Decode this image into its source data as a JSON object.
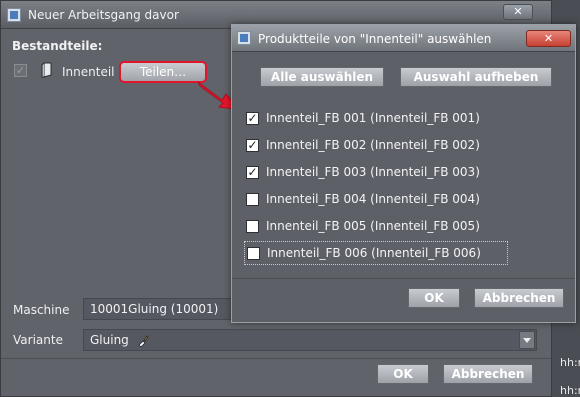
{
  "main_dialog": {
    "title": "Neuer Arbeitsgang davor",
    "close_label": "✕",
    "section_label": "Bestandteile:",
    "part_checked": true,
    "part_label": "Innenteil",
    "teilen_label": "Teilen…",
    "maschine_label": "Maschine",
    "maschine_value": "10001Gluing (10001)",
    "variante_label": "Variante",
    "variante_value": "Gluing",
    "ok_label": "OK",
    "cancel_label": "Abbrechen"
  },
  "popup": {
    "title": "Produktteile von \"Innenteil\" auswählen",
    "close_label": "✕",
    "select_all_label": "Alle auswählen",
    "deselect_label": "Auswahl aufheben",
    "items": [
      {
        "label": "Innenteil_FB 001 (Innenteil_FB 001)",
        "checked": true
      },
      {
        "label": "Innenteil_FB 002 (Innenteil_FB 002)",
        "checked": true
      },
      {
        "label": "Innenteil_FB 003 (Innenteil_FB 003)",
        "checked": true
      },
      {
        "label": "Innenteil_FB 004 (Innenteil_FB 004)",
        "checked": false
      },
      {
        "label": "Innenteil_FB 005 (Innenteil_FB 005)",
        "checked": false
      },
      {
        "label": "Innenteil_FB 006 (Innenteil_FB 006)",
        "checked": false
      }
    ],
    "ok_label": "OK",
    "cancel_label": "Abbrechen"
  },
  "background": {
    "text_1": "hh:m",
    "text_2": "hh:m"
  },
  "colors": {
    "highlight_red": "#e2162b",
    "dialog_bg": "#606369"
  },
  "icons": {
    "window": "app-window-icon",
    "part": "document-part-icon",
    "gluing": "glue-brush-icon",
    "pointer": "red-arrow-icon"
  }
}
